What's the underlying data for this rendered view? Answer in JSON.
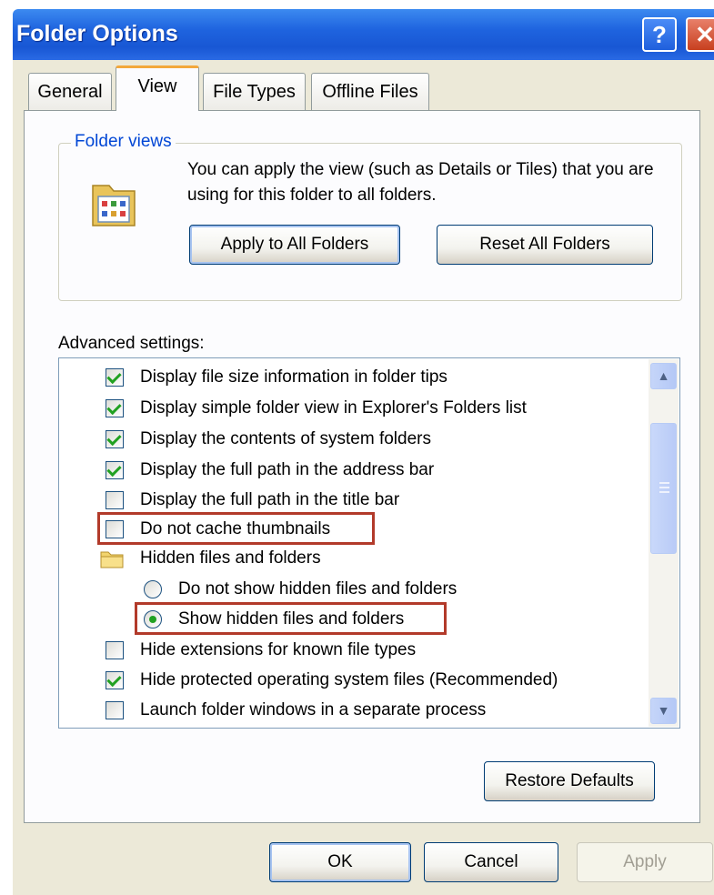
{
  "window": {
    "title": "Folder Options",
    "help_label": "?",
    "close_label": "✕"
  },
  "tabs": [
    {
      "label": "General",
      "active": false
    },
    {
      "label": "View",
      "active": true
    },
    {
      "label": "File Types",
      "active": false
    },
    {
      "label": "Offline Files",
      "active": false
    }
  ],
  "folder_views": {
    "legend": "Folder views",
    "description": "You can apply the view (such as Details or Tiles) that you are using for this folder to all folders.",
    "apply_label": "Apply to All Folders",
    "reset_label": "Reset All Folders",
    "icon": "folder-views-icon"
  },
  "advanced": {
    "label": "Advanced settings:",
    "items": [
      {
        "type": "checkbox",
        "checked": true,
        "label": "Display file size information in folder tips"
      },
      {
        "type": "checkbox",
        "checked": true,
        "label": "Display simple folder view in Explorer's Folders list"
      },
      {
        "type": "checkbox",
        "checked": true,
        "label": "Display the contents of system folders"
      },
      {
        "type": "checkbox",
        "checked": true,
        "label": "Display the full path in the address bar"
      },
      {
        "type": "checkbox",
        "checked": false,
        "label": "Display the full path in the title bar"
      },
      {
        "type": "checkbox",
        "checked": false,
        "label": "Do not cache thumbnails",
        "highlighted": true
      },
      {
        "type": "folder",
        "label": "Hidden files and folders"
      },
      {
        "type": "radio",
        "selected": false,
        "label": "Do not show hidden files and folders"
      },
      {
        "type": "radio",
        "selected": true,
        "label": "Show hidden files and folders",
        "highlighted": true
      },
      {
        "type": "checkbox",
        "checked": false,
        "label": "Hide extensions for known file types"
      },
      {
        "type": "checkbox",
        "checked": true,
        "label": "Hide protected operating system files (Recommended)"
      },
      {
        "type": "checkbox",
        "checked": false,
        "label": "Launch folder windows in a separate process"
      }
    ]
  },
  "restore_label": "Restore Defaults",
  "footer": {
    "ok_label": "OK",
    "cancel_label": "Cancel",
    "apply_label": "Apply",
    "apply_enabled": false
  },
  "colors": {
    "accent": "#0046d5",
    "highlight": "#b23a2a",
    "check": "#21a121",
    "titlebar": "#1f64df"
  }
}
